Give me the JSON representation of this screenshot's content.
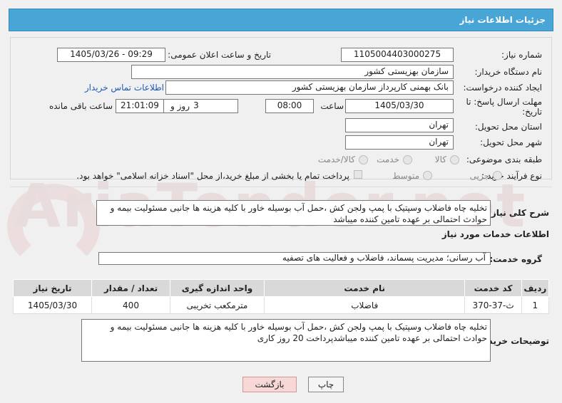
{
  "title": "جزئیات اطلاعات نیاز",
  "watermark": "AriaTender.net",
  "fields": {
    "need_number_label": "شماره نیاز:",
    "need_number": "1105004403000275",
    "announce_label": "تاریخ و ساعت اعلان عمومی:",
    "announce_value": "1405/03/26 - 09:29",
    "buyer_org_label": "نام دستگاه خریدار:",
    "buyer_org": "سازمان بهزیستی کشور",
    "creator_label": "ایجاد کننده درخواست:",
    "creator": "بانک بهمنی کارپرداز سازمان بهزیستی کشور",
    "contact_link": "اطلاعات تماس خریدار",
    "deadline_label_1": "مهلت ارسال پاسخ: تا",
    "deadline_label_2": "تاریخ:",
    "deadline_date": "1405/03/30",
    "time_label": "ساعت",
    "deadline_time": "08:00",
    "days_value": "3",
    "days_label": "روز و",
    "remaining_time": "21:01:09",
    "remaining_label": "ساعت باقی مانده",
    "province_label": "استان محل تحویل:",
    "province": "تهران",
    "city_label": "شهر محل تحویل:",
    "city": "تهران",
    "category_label": "طبقه بندی موضوعی:",
    "category_options": [
      "کالا",
      "خدمت",
      "کالا/خدمت"
    ],
    "process_label": "نوع فرآیند خرید :",
    "process_options": [
      "جزیی",
      "متوسط"
    ],
    "payment_note": "پرداخت تمام یا بخشی از مبلغ خرید،از محل \"اسناد خزانه اسلامی\" خواهد بود."
  },
  "summary": {
    "label": "شرح کلی نیاز:",
    "text": "تخلیه چاه فاضلاب وسپتیک با پمپ ولجن کش ،حمل آب بوسیله خاور با کلیه هزینه ها جانبی مسئولیت بیمه و حوادث احتمالی بر عهده تامین کننده میباشد"
  },
  "services": {
    "section_title": "اطلاعات خدمات مورد نیاز",
    "group_label": "گروه خدمت:",
    "group_value": "آب رسانی؛ مدیریت پسماند، فاضلاب و فعالیت های تصفیه",
    "columns": [
      "ردیف",
      "کد خدمت",
      "نام خدمت",
      "واحد اندازه گیری",
      "تعداد / مقدار",
      "تاریخ نیاز"
    ],
    "rows": [
      [
        "1",
        "ث-37-370",
        "فاضلاب",
        "مترمکعب تخریبی",
        "400",
        "1405/03/30"
      ]
    ]
  },
  "buyer_notes": {
    "label": "توضیحات خریدار:",
    "text": "تخلیه چاه فاضلاب وسپتیک با پمپ ولجن کش ،حمل آب بوسیله خاور با کلیه هزینه ها جانبی مسئولیت بیمه و حوادث احتمالی بر عهده تامین کننده میباشدپرداخت 20 روز کاری"
  },
  "buttons": {
    "print": "چاپ",
    "back": "بازگشت"
  }
}
